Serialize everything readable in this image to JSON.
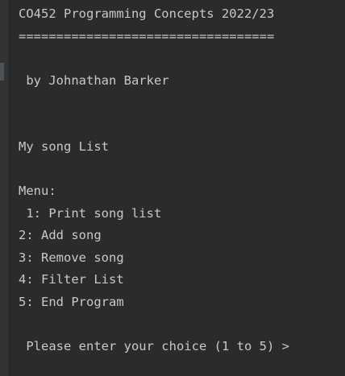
{
  "console": {
    "header": {
      "title": "CO452 Programming Concepts 2022/23",
      "rule": "=================================="
    },
    "author": " by Johnathan Barker",
    "list_title": "My song List",
    "menu": {
      "label": "Menu:",
      "items": [
        " 1: Print song list",
        "2: Add song",
        "3: Remove song",
        "4: Filter List",
        "5: End Program"
      ]
    },
    "prompt": " Please enter your choice (1 to 5) >"
  },
  "colors": {
    "background": "#2b2b2b",
    "text": "#c8c8c8",
    "gutter": "#313335"
  }
}
